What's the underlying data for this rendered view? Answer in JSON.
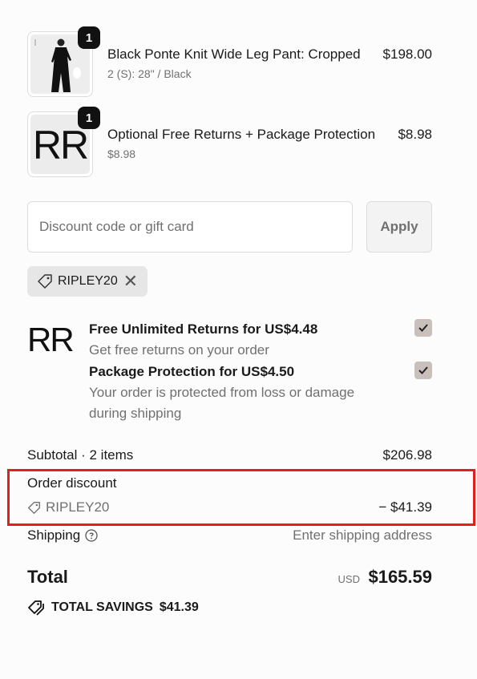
{
  "items": [
    {
      "quantity": "1",
      "name": "Black Ponte Knit Wide Leg Pant: Cropped",
      "variant": "2 (S): 28\" / Black",
      "price": "$198.00",
      "thumb": "model-black-outfit-image"
    },
    {
      "quantity": "1",
      "name": "Optional Free Returns + Package Protection",
      "variant": "$8.98",
      "price": "$8.98",
      "thumb_logo": "RR"
    }
  ],
  "discount": {
    "placeholder": "Discount code or gift card",
    "apply_label": "Apply"
  },
  "applied_code": {
    "code": "RIPLEY20",
    "icon": "tag-icon",
    "remove_icon": "close-icon"
  },
  "addons": {
    "logo": "RR",
    "returns_title": "Free Unlimited Returns for US$4.48",
    "returns_desc": "Get free returns on your order",
    "protection_title": "Package Protection for US$4.50",
    "protection_desc": "Your order is protected from loss or damage during shipping"
  },
  "summary": {
    "subtotal_label": "Subtotal · 2 items",
    "subtotal_value": "$206.98",
    "order_discount_label": "Order discount",
    "order_discount_code": "RIPLEY20",
    "order_discount_value": "− $41.39",
    "shipping_label": "Shipping",
    "shipping_value": "Enter shipping address",
    "total_label": "Total",
    "total_currency": "USD",
    "total_value": "$165.59",
    "savings_label": "TOTAL SAVINGS",
    "savings_value": "$41.39"
  },
  "colors": {
    "highlight": "#e02020",
    "checkbox": "#c9c0bb"
  }
}
